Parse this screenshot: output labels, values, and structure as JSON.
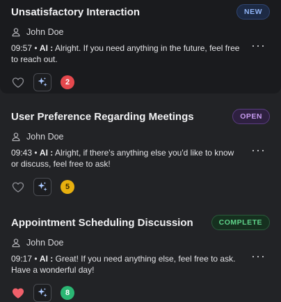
{
  "conversations": [
    {
      "title": "Unsatisfactory Interaction",
      "status": "NEW",
      "status_fg": "#8fb3f5",
      "status_bg": "#1d2a44",
      "status_border": "#2f4470",
      "user": "John Doe",
      "time": "09:57",
      "sender": "AI :",
      "message": "Alright. If you need anything in the future, feel free to reach out.",
      "liked": false,
      "count": "2",
      "count_bg": "#e5484d",
      "count_fg": "#ffffff",
      "user_icon": "user-icon",
      "heart_icon": "heart-outline-icon",
      "ai_icon": "sparkles-icon",
      "more_icon": "more-horizontal-icon"
    },
    {
      "title": "User Preference Regarding Meetings",
      "status": "OPEN",
      "status_fg": "#c79bf0",
      "status_bg": "#2e2040",
      "status_border": "#5a3c80",
      "user": "John Doe",
      "time": "09:43",
      "sender": "AI :",
      "message": "Alright, if there's anything else you'd like to know or discuss, feel free to ask!",
      "liked": false,
      "count": "5",
      "count_bg": "#e8b00f",
      "count_fg": "#3a2a00",
      "user_icon": "user-icon",
      "heart_icon": "heart-outline-icon",
      "ai_icon": "sparkles-icon",
      "more_icon": "more-horizontal-icon"
    },
    {
      "title": "Appointment Scheduling Discussion",
      "status": "COMPLETE",
      "status_fg": "#5fd38a",
      "status_bg": "#16301f",
      "status_border": "#2a5a3b",
      "user": "John Doe",
      "time": "09:17",
      "sender": "AI :",
      "message": "Great! If you need anything else, feel free to ask. Have a wonderful day!",
      "liked": true,
      "count": "8",
      "count_bg": "#2bb673",
      "count_fg": "#ffffff",
      "user_icon": "user-icon",
      "heart_icon": "heart-filled-icon",
      "ai_icon": "sparkles-icon",
      "more_icon": "more-horizontal-icon"
    }
  ]
}
